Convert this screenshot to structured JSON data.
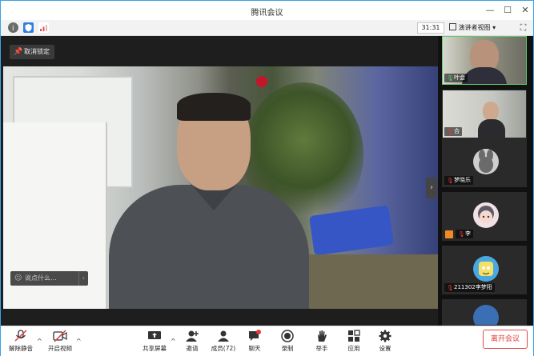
{
  "window": {
    "title": "腾讯会议",
    "controls": {
      "minimize": "—",
      "maximize": "☐",
      "close": "✕"
    }
  },
  "infobar": {
    "timer": "31:31",
    "view_label": "演讲者视图",
    "view_caret": "▾",
    "fullscreen": "⛶"
  },
  "stage": {
    "cancel_focus_label": "取消锁定",
    "chat_placeholder": "说点什么...",
    "chat_chevron": "‹",
    "collapse_glyph": "›"
  },
  "participants": [
    {
      "name": "叶会",
      "mic": "on"
    },
    {
      "name": "合",
      "mic": "off"
    },
    {
      "name": "梦晓乐",
      "mic": "off"
    },
    {
      "name": "李",
      "mic": "off"
    },
    {
      "name": "211302李梦阳",
      "mic": "off"
    },
    {
      "name": "",
      "mic": "off"
    }
  ],
  "toolbar": {
    "mute": "解除静音",
    "video": "开启视频",
    "share": "共享屏幕",
    "invite": "邀请",
    "members": "成员(72)",
    "chat": "聊天",
    "record": "录制",
    "raise_hand": "举手",
    "apps": "应用",
    "settings": "设置",
    "leave": "离开会议",
    "caret": "^"
  },
  "colors": {
    "accent": "#3aa0e8",
    "leave": "#e03a3a",
    "active_speaker": "#5fc96b",
    "muted": "#e03a3a"
  }
}
